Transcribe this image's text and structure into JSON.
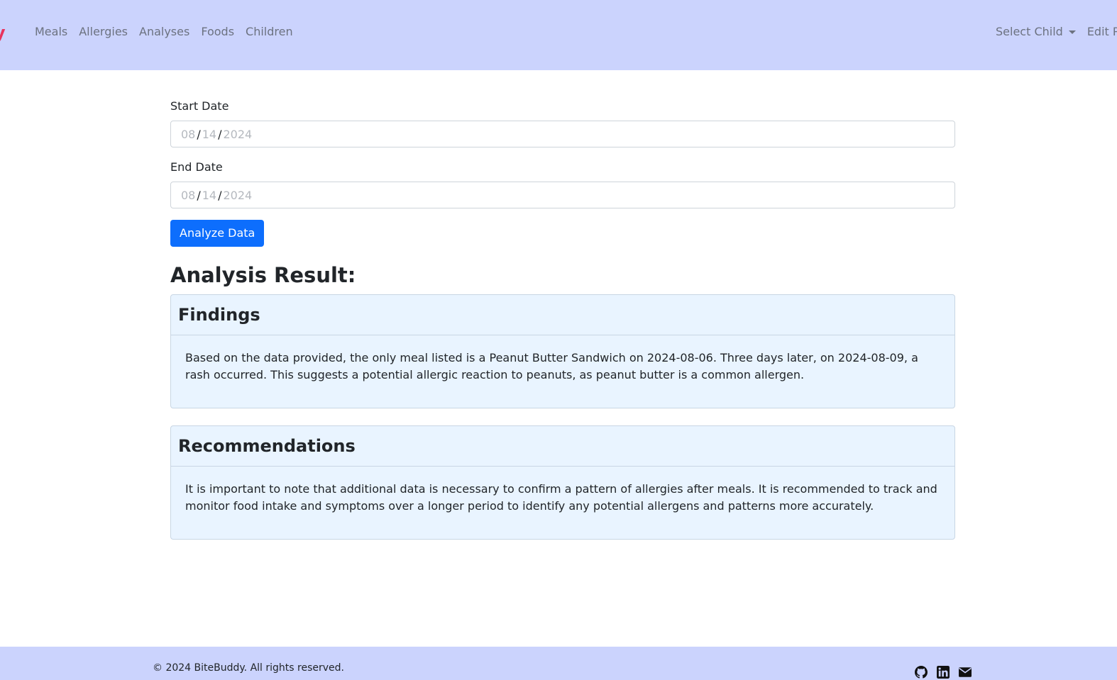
{
  "navbar": {
    "brand_glyph": "y",
    "links": [
      "Meals",
      "Allergies",
      "Analyses",
      "Foods",
      "Children"
    ],
    "select_child_label": "Select Child",
    "edit_label": "Edit Profile"
  },
  "form": {
    "start_date_label": "Start Date",
    "start_date": {
      "month": "08",
      "day": "14",
      "year": "2024"
    },
    "end_date_label": "End Date",
    "end_date": {
      "month": "08",
      "day": "14",
      "year": "2024"
    },
    "analyze_button": "Analyze Data",
    "date_separator": "/"
  },
  "result": {
    "title": "Analysis Result:",
    "findings_title": "Findings",
    "findings_text": "Based on the data provided, the only meal listed is a Peanut Butter Sandwich on 2024-08-06. Three days later, on 2024-08-09, a rash occurred. This suggests a potential allergic reaction to peanuts, as peanut butter is a common allergen.",
    "recommendations_title": "Recommendations",
    "recommendations_text": "It is important to note that additional data is necessary to confirm a pattern of allergies after meals. It is recommended to track and monitor food intake and symptoms over a longer period to identify any potential allergens and patterns more accurately."
  },
  "footer": {
    "copyright": "© 2024 BiteBuddy. All rights reserved.",
    "social_icons": [
      "github-icon",
      "linkedin-icon",
      "envelope-icon"
    ]
  },
  "colors": {
    "navbar_bg": "#cbd3fd",
    "brand": "#e8325c",
    "primary_button": "#0d6efd",
    "card_bg": "#e9f4ff"
  }
}
